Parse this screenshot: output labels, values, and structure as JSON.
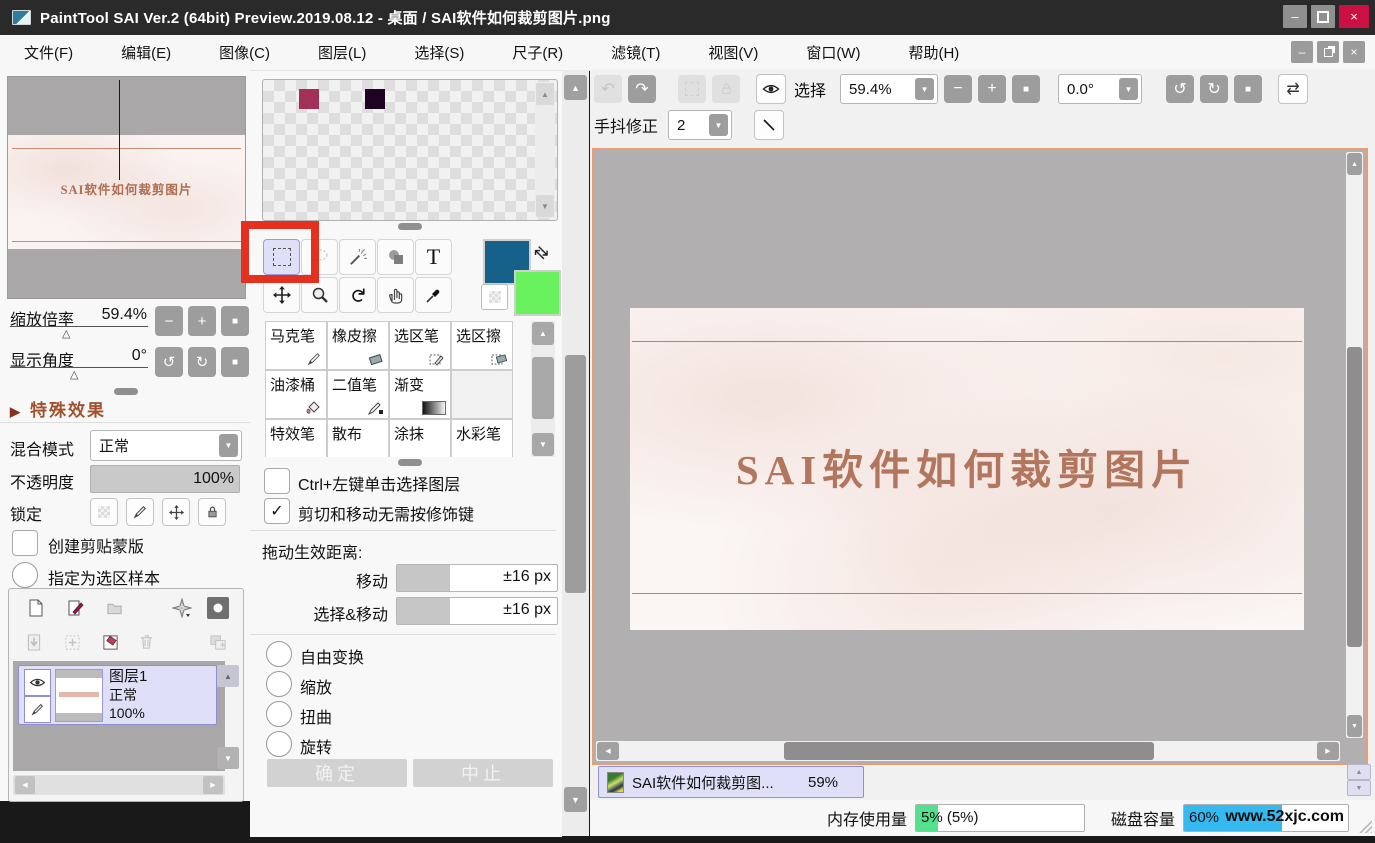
{
  "titlebar": {
    "title": "PaintTool SAI Ver.2 (64bit) Preview.2019.08.12 - 桌面 / SAI软件如何裁剪图片.png"
  },
  "menubar": {
    "items": [
      "文件(F)",
      "编辑(E)",
      "图像(C)",
      "图层(L)",
      "选择(S)",
      "尺子(R)",
      "滤镜(T)",
      "视图(V)",
      "窗口(W)",
      "帮助(H)"
    ]
  },
  "glyphs": {
    "minus": "−",
    "plus": "+",
    "stop": "■",
    "up": "▲",
    "down": "▼",
    "left": "◀",
    "right": "▶",
    "undo": "↶",
    "redo": "↷",
    "ccw": "↺",
    "cw": "↻",
    "flip": "⇄",
    "check": "✓",
    "tri": "△",
    "close": "×",
    "min": "–",
    "text_tool": "T"
  },
  "toolbar": {
    "selection_label": "选择",
    "zoom_value": "59.4%",
    "angle_value": "0.0°",
    "stabilizer_label": "手抖修正",
    "stabilizer_value": "2"
  },
  "navigator": {
    "preview_text": "SAI软件如何裁剪图片",
    "zoom_label": "缩放倍率",
    "zoom_value": "59.4%",
    "angle_label": "显示角度",
    "angle_value": "0°"
  },
  "special": {
    "header": "特殊效果",
    "blend_label": "混合模式",
    "blend_value": "正常",
    "opacity_label": "不透明度",
    "opacity_value": "100%",
    "lock_label": "锁定",
    "clip_checkbox": "创建剪贴蒙版",
    "selection_radio": "指定为选区样本"
  },
  "layers": {
    "name": "图层1",
    "mode": "正常",
    "opacity": "100%"
  },
  "brushes": {
    "items": [
      "马克笔",
      "橡皮擦",
      "选区笔",
      "选区擦",
      "油漆桶",
      "二值笔",
      "渐变",
      "",
      "特效笔",
      "散布",
      "涂抹",
      "水彩笔"
    ]
  },
  "options": {
    "checkbox1": "Ctrl+左键单击选择图层",
    "checkbox2": "剪切和移动无需按修饰键",
    "drag_label": "拖动生效距离:",
    "move_label": "移动",
    "move_value": "±16 px",
    "selmove_label": "选择&移动",
    "selmove_value": "±16 px",
    "radios": [
      "自由变换",
      "缩放",
      "扭曲",
      "旋转"
    ],
    "ok": "确定",
    "abort": "中止"
  },
  "canvas": {
    "text": "SAI软件如何裁剪图片"
  },
  "doc_tab": {
    "title": "SAI软件如何裁剪图...",
    "zoom": "59%"
  },
  "status": {
    "memory_label": "内存使用量",
    "memory_value": "5% (5%)",
    "disk_label": "磁盘容量",
    "disk_value": "60%",
    "watermark": "www.52xjc.com"
  },
  "colors": {
    "primary": "#15618a",
    "secondary": "#69f25e",
    "swatch1": "#a23058",
    "swatch2": "#1f0322",
    "annotation_red": "#e53020",
    "memory_green": "#55e08e",
    "disk_blue": "#35b9ee",
    "canvas_border_orange": "#eb9d6f",
    "special_brown": "#a0522d"
  }
}
